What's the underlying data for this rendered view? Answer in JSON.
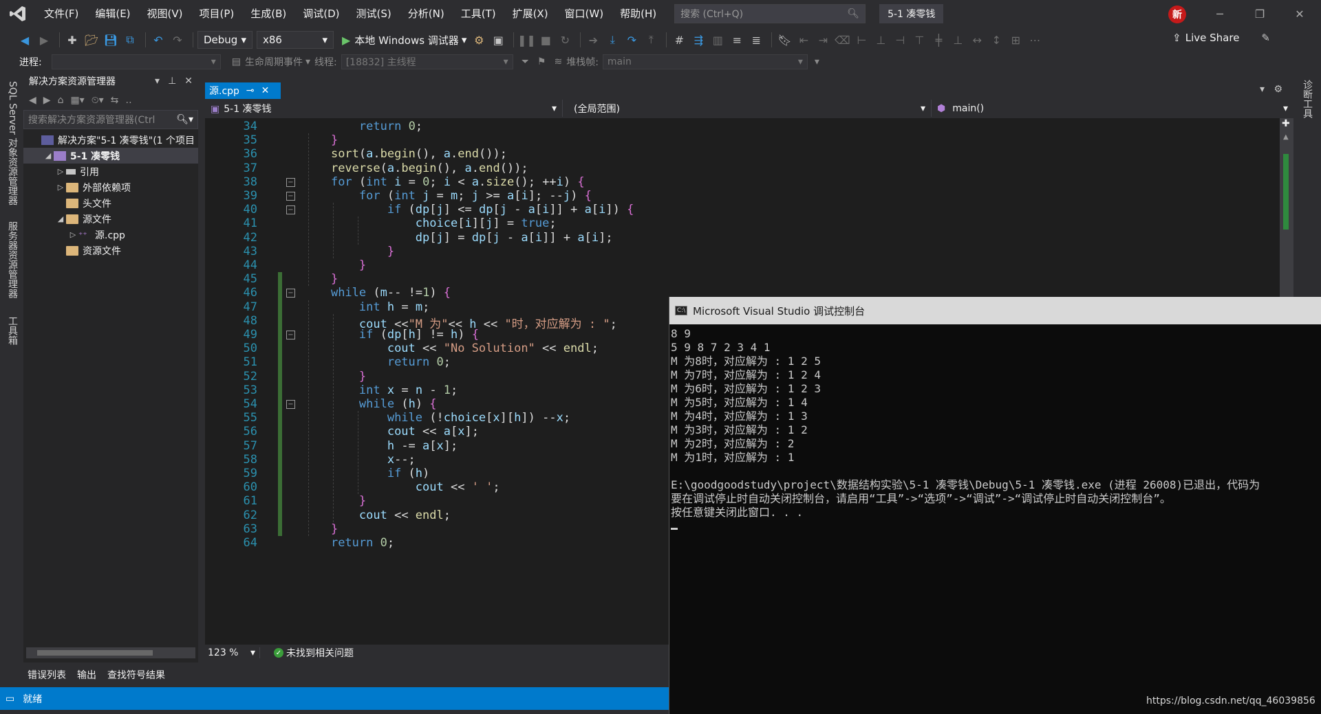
{
  "menu": {
    "items": [
      "文件(F)",
      "编辑(E)",
      "视图(V)",
      "项目(P)",
      "生成(B)",
      "调试(D)",
      "测试(S)",
      "分析(N)",
      "工具(T)",
      "扩展(X)",
      "窗口(W)",
      "帮助(H)"
    ],
    "search_placeholder": "搜索 (Ctrl+Q)",
    "solution_name": "5-1 凑零钱",
    "user_badge": "新"
  },
  "toolbar": {
    "config": "Debug",
    "platform": "x86",
    "run_label": "本地 Windows 调试器",
    "live_share": "Live Share"
  },
  "process_bar": {
    "process_label": "进程:",
    "lifecycle_label": "生命周期事件",
    "thread_label": "线程:",
    "thread_value": "[18832] 主线程",
    "stack_label": "堆栈帧:",
    "stack_value": "main"
  },
  "left_strip_tabs": [
    "SQL Server 对象资源管理器",
    "服务器资源管理器",
    "工具箱"
  ],
  "right_strip_tabs": [
    "诊断工具"
  ],
  "solution_explorer": {
    "title": "解决方案资源管理器",
    "search_placeholder": "搜索解决方案资源管理器(Ctrl",
    "tree": [
      {
        "label": "解决方案\"5-1 凑零钱\"(1 个项目",
        "indent": 0,
        "toggle": "",
        "icon": "sln",
        "selected": false
      },
      {
        "label": "5-1 凑零钱",
        "indent": 1,
        "toggle": "▲",
        "icon": "proj",
        "selected": true
      },
      {
        "label": "引用",
        "indent": 2,
        "toggle": "▷",
        "icon": "ref",
        "selected": false
      },
      {
        "label": "外部依赖项",
        "indent": 2,
        "toggle": "▷",
        "icon": "folder",
        "selected": false
      },
      {
        "label": "头文件",
        "indent": 2,
        "toggle": "",
        "icon": "folder",
        "selected": false
      },
      {
        "label": "源文件",
        "indent": 2,
        "toggle": "▲",
        "icon": "folder",
        "selected": false
      },
      {
        "label": "源.cpp",
        "indent": 3,
        "toggle": "▷",
        "icon": "cpp",
        "selected": false
      },
      {
        "label": "资源文件",
        "indent": 2,
        "toggle": "",
        "icon": "folder",
        "selected": false
      }
    ]
  },
  "bottom_tabs": [
    "错误列表",
    "输出",
    "查找符号结果"
  ],
  "editor": {
    "tab_label": "源.cpp",
    "nav_project": "5-1 凑零钱",
    "nav_scope": "(全局范围)",
    "nav_member": "main()",
    "zoom": "123 %",
    "issues": "未找到相关问题",
    "lines": [
      {
        "no": "34",
        "html": "        <span class='kw'>return</span> <span class='num'>0</span>;"
      },
      {
        "no": "35",
        "html": "    <span class='br'>}</span>"
      },
      {
        "no": "36",
        "html": "    <span class='fn'>sort</span>(<span class='var'>a</span>.<span class='fn'>begin</span>(), <span class='var'>a</span>.<span class='fn'>end</span>());"
      },
      {
        "no": "37",
        "html": "    <span class='fn'>reverse</span>(<span class='var'>a</span>.<span class='fn'>begin</span>(), <span class='var'>a</span>.<span class='fn'>end</span>());"
      },
      {
        "no": "38",
        "html": "    <span class='kw'>for</span> (<span class='ty'>int</span> <span class='var'>i</span> = <span class='num'>0</span>; <span class='var'>i</span> &lt; <span class='var'>a</span>.<span class='fn'>size</span>(); ++<span class='var'>i</span>) <span class='br'>{</span>"
      },
      {
        "no": "39",
        "html": "        <span class='kw'>for</span> (<span class='ty'>int</span> <span class='var'>j</span> = <span class='var'>m</span>; <span class='var'>j</span> &gt;= <span class='var'>a</span>[<span class='var'>i</span>]; --<span class='var'>j</span>) <span class='br'>{</span>"
      },
      {
        "no": "40",
        "html": "            <span class='kw'>if</span> (<span class='var'>dp</span>[<span class='var'>j</span>] &lt;= <span class='var'>dp</span>[<span class='var'>j</span> - <span class='var'>a</span>[<span class='var'>i</span>]] + <span class='var'>a</span>[<span class='var'>i</span>]) <span class='br'>{</span>"
      },
      {
        "no": "41",
        "html": "                <span class='var'>choice</span>[<span class='var'>i</span>][<span class='var'>j</span>] = <span class='kw'>true</span>;"
      },
      {
        "no": "42",
        "html": "                <span class='var'>dp</span>[<span class='var'>j</span>] = <span class='var'>dp</span>[<span class='var'>j</span> - <span class='var'>a</span>[<span class='var'>i</span>]] + <span class='var'>a</span>[<span class='var'>i</span>];"
      },
      {
        "no": "43",
        "html": "            <span class='br'>}</span>"
      },
      {
        "no": "44",
        "html": "        <span class='br'>}</span>"
      },
      {
        "no": "45",
        "html": "    <span class='br'>}</span>"
      },
      {
        "no": "46",
        "html": "    <span class='kw'>while</span> (<span class='var'>m</span>-- !=<span class='num'>1</span>) <span class='br'>{</span>"
      },
      {
        "no": "47",
        "html": "        <span class='ty'>int</span> <span class='var'>h</span> = <span class='var'>m</span>;"
      },
      {
        "no": "48",
        "html": "        <span class='var'>cout</span> &lt;&lt;<span class='str'>\"M 为\"</span>&lt;&lt; <span class='var'>h</span> &lt;&lt; <span class='str'>\"时，对应解为 : \"</span>;"
      },
      {
        "no": "49",
        "html": "        <span class='kw'>if</span> (<span class='var'>dp</span>[<span class='var'>h</span>] != <span class='var'>h</span>) <span class='br'>{</span>"
      },
      {
        "no": "50",
        "html": "            <span class='var'>cout</span> &lt;&lt; <span class='str'>\"No Solution\"</span> &lt;&lt; <span class='fn'>endl</span>;"
      },
      {
        "no": "51",
        "html": "            <span class='kw'>return</span> <span class='num'>0</span>;"
      },
      {
        "no": "52",
        "html": "        <span class='br'>}</span>"
      },
      {
        "no": "53",
        "html": "        <span class='ty'>int</span> <span class='var'>x</span> = <span class='var'>n</span> - <span class='num'>1</span>;"
      },
      {
        "no": "54",
        "html": "        <span class='kw'>while</span> (<span class='var'>h</span>) <span class='br'>{</span>"
      },
      {
        "no": "55",
        "html": "            <span class='kw'>while</span> (!<span class='var'>choice</span>[<span class='var'>x</span>][<span class='var'>h</span>]) --<span class='var'>x</span>;"
      },
      {
        "no": "56",
        "html": "            <span class='var'>cout</span> &lt;&lt; <span class='var'>a</span>[<span class='var'>x</span>];"
      },
      {
        "no": "57",
        "html": "            <span class='var'>h</span> -= <span class='var'>a</span>[<span class='var'>x</span>];"
      },
      {
        "no": "58",
        "html": "            <span class='var'>x</span>--;"
      },
      {
        "no": "59",
        "html": "            <span class='kw'>if</span> (<span class='var'>h</span>)"
      },
      {
        "no": "60",
        "html": "                <span class='var'>cout</span> &lt;&lt; <span class='str'>' '</span>;"
      },
      {
        "no": "61",
        "html": "        <span class='br'>}</span>"
      },
      {
        "no": "62",
        "html": "        <span class='var'>cout</span> &lt;&lt; <span class='fn'>endl</span>;"
      },
      {
        "no": "63",
        "html": "    <span class='br'>}</span>"
      },
      {
        "no": "64",
        "html": "    <span class='kw'>return</span> <span class='num'>0</span>;"
      }
    ]
  },
  "console": {
    "title": "Microsoft Visual Studio 调试控制台",
    "lines": [
      "8 9",
      "5 9 8 7 2 3 4 1",
      "M 为8时，对应解为 : 1 2 5",
      "M 为7时，对应解为 : 1 2 4",
      "M 为6时，对应解为 : 1 2 3",
      "M 为5时，对应解为 : 1 4",
      "M 为4时，对应解为 : 1 3",
      "M 为3时，对应解为 : 1 2",
      "M 为2时，对应解为 : 2",
      "M 为1时，对应解为 : 1",
      "",
      "E:\\goodgoodstudy\\project\\数据结构实验\\5-1 凑零钱\\Debug\\5-1 凑零钱.exe (进程 26008)已退出，代码为",
      "要在调试停止时自动关闭控制台，请启用“工具”->“选项”->“调试”->“调试停止时自动关闭控制台”。",
      "按任意键关闭此窗口. . ."
    ]
  },
  "status": {
    "text": "就绪",
    "watermark": "https://blog.csdn.net/qq_46039856"
  },
  "colors": {
    "accent": "#007acc",
    "editor_bg": "#1e1e1e",
    "chrome_bg": "#2d2d30",
    "change_bar": "#3b6e35"
  }
}
